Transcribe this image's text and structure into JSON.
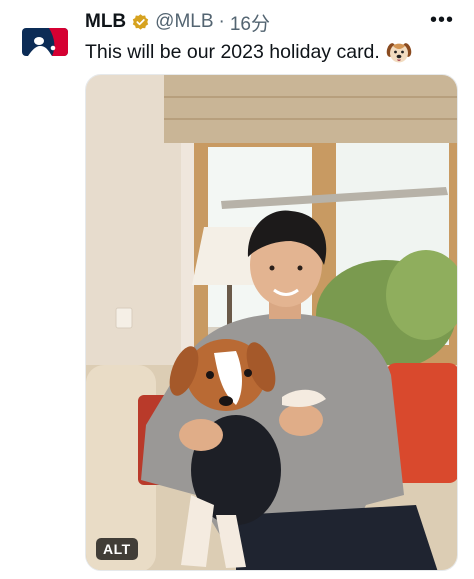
{
  "post": {
    "author_name": "MLB",
    "handle": "@MLB",
    "separator": "·",
    "time": "16分",
    "text": "This will be our 2023 holiday card.",
    "text_emoji": "dog-face-emoji",
    "more_label": "•••",
    "media": {
      "alt_label": "ALT"
    }
  },
  "colors": {
    "verified_badge": "#d6a21f",
    "secondary_text": "#536471",
    "logo_blue": "#0c2c56",
    "logo_red": "#d50032"
  }
}
